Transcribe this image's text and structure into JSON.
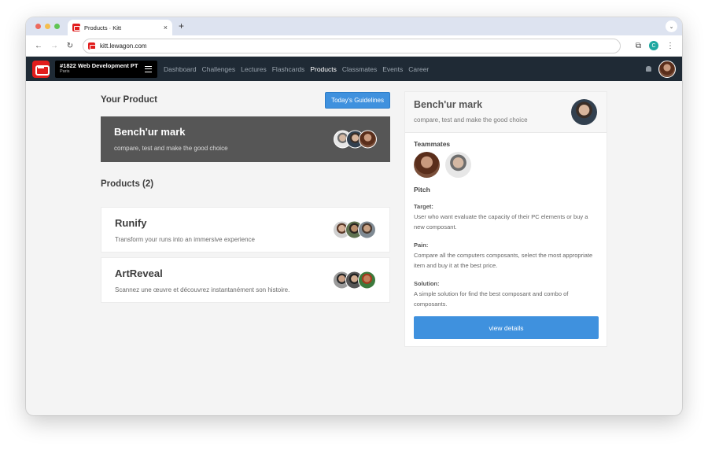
{
  "browser": {
    "tab_title": "Products · Kitt",
    "tab_close": "×",
    "new_tab": "+",
    "tab_dropdown": "⌄",
    "url": "kitt.lewagon.com",
    "back": "←",
    "forward": "→",
    "reload": "↻",
    "profile_initial": "C",
    "extensions_glyph": "⧉",
    "menu_glyph": "⋮"
  },
  "navbar": {
    "batch_name": "#1822 Web Development PT",
    "batch_city": "Paris",
    "menu": [
      "Dashboard",
      "Challenges",
      "Lectures",
      "Flashcards",
      "Products",
      "Classmates",
      "Events",
      "Career"
    ],
    "active_item": "Products"
  },
  "your_product": {
    "heading": "Your Product",
    "guidelines_button": "Today's Guidelines",
    "name": "Bench'ur mark",
    "tagline": "compare, test and make the good choice"
  },
  "products": {
    "heading": "Products (2)",
    "items": [
      {
        "name": "Runify",
        "tagline": "Transform your runs into an immersive experience"
      },
      {
        "name": "ArtReveal",
        "tagline": "Scannez une œuvre et découvrez instantanément son histoire."
      }
    ]
  },
  "detail": {
    "name": "Bench'ur mark",
    "tagline": "compare, test and make the good choice",
    "teammates_heading": "Teammates",
    "pitch_heading": "Pitch",
    "target_label": "Target:",
    "target_text": "User who want evaluate the capacity of their PC elements or buy a new composant.",
    "pain_label": "Pain:",
    "pain_text": "Compare all the computers composants, select the most appropriate item and buy it at the best price.",
    "solution_label": "Solution:",
    "solution_text": "A simple solution for find the best composant and combo of composants.",
    "view_button": "view details"
  },
  "colors": {
    "navbar_bg": "#1f2a35",
    "accent_blue": "#3f91de",
    "brand_red": "#e11d1d",
    "featured_card_bg": "#565656"
  }
}
